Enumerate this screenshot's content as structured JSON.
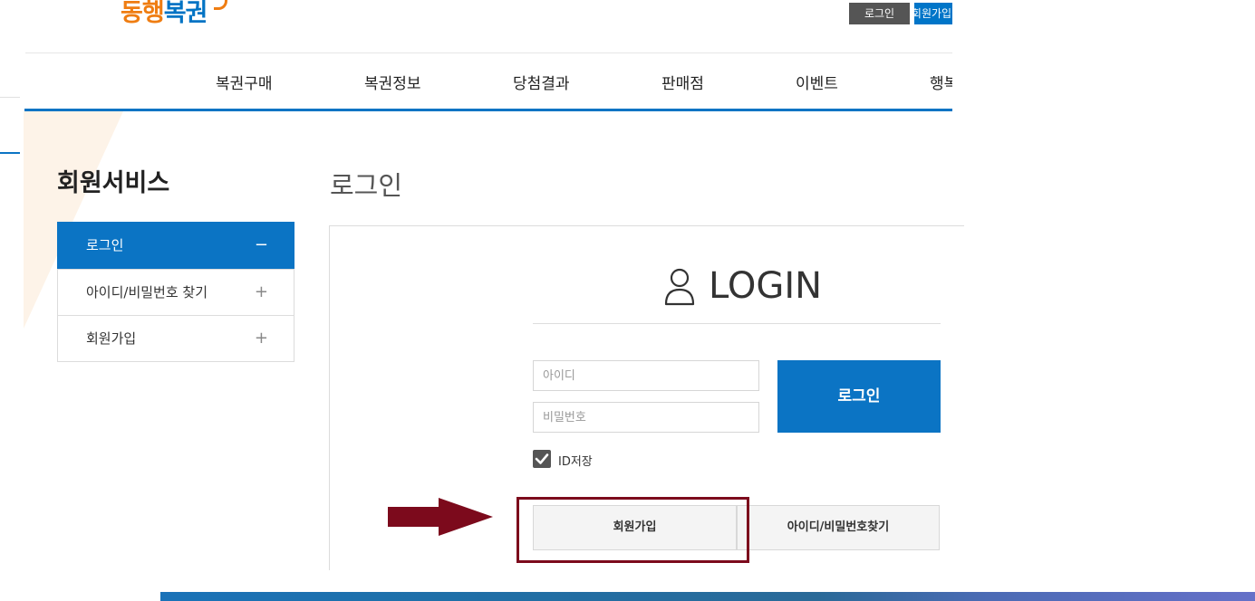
{
  "header": {
    "logo_part1": "동행",
    "logo_part2": "복권",
    "login_button": "로그인",
    "join_button": "회원가입"
  },
  "nav": [
    "복권구매",
    "복권정보",
    "당첨결과",
    "판매점",
    "이벤트",
    "행복"
  ],
  "side": {
    "title": "회원서비스",
    "items": [
      {
        "label": "로그인",
        "sign": "−",
        "active": true
      },
      {
        "label": "아이디/비밀번호 찾기",
        "sign": "+"
      },
      {
        "label": "회원가입",
        "sign": "+"
      }
    ]
  },
  "main": {
    "title": "로그인",
    "login_heading": "LOGIN",
    "id_placeholder": "아이디",
    "pw_placeholder": "비밀번호",
    "login_button": "로그인",
    "save_id_label": "ID저장",
    "save_id_checked": true,
    "join_button": "회원가입",
    "find_button": "아이디/비밀번호찾기"
  },
  "colors": {
    "brand_blue": "#0b74c4",
    "brand_orange": "#ef7d12",
    "highlight": "#7c0a1c"
  },
  "icons": [
    "user-icon",
    "check-icon",
    "arrow-right-icon"
  ]
}
